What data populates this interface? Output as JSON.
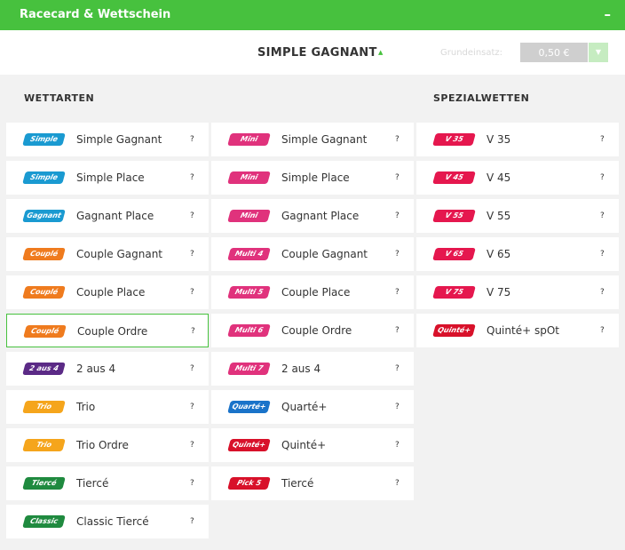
{
  "header": {
    "title": "Racecard & Wettschein",
    "toggle": "–"
  },
  "betbar": {
    "bet_type": "SIMPLE GAGNANT",
    "caret": "▲",
    "stake_label": "Grundeinsatz:",
    "stake_value": "0,50 €",
    "dropdown": "▼"
  },
  "sections": {
    "wettarten": "WETTARTEN",
    "spezialwetten": "SPEZIALWETTEN"
  },
  "help": "?",
  "colors": {
    "accent": "#47c13e"
  },
  "col1": [
    {
      "logo": "Simple",
      "label": "Simple Gagnant",
      "color": "#1a9ad1",
      "icon": "simple-gagnant-logo"
    },
    {
      "logo": "Simple",
      "label": "Simple Place",
      "color": "#1a9ad1",
      "icon": "simple-place-logo"
    },
    {
      "logo": "Gagnant",
      "label": "Gagnant Place",
      "color": "#1a9ad1",
      "icon": "gagnant-place-logo"
    },
    {
      "logo": "Couplé",
      "label": "Couple Gagnant",
      "color": "#ef7b1e",
      "icon": "couple-gagnant-logo"
    },
    {
      "logo": "Couplé",
      "label": "Couple Place",
      "color": "#ef7b1e",
      "icon": "couple-place-logo"
    },
    {
      "logo": "Couplé",
      "label": "Couple Ordre",
      "color": "#ef7b1e",
      "icon": "couple-ordre-logo",
      "selected": true
    },
    {
      "logo": "2 aus 4",
      "label": "2 aus 4",
      "color": "#5b2a86",
      "icon": "2-aus-4-logo"
    },
    {
      "logo": "Trio",
      "label": "Trio",
      "color": "#f5a51c",
      "icon": "trio-logo"
    },
    {
      "logo": "Trio",
      "label": "Trio Ordre",
      "color": "#f5a51c",
      "icon": "trio-ordre-logo"
    },
    {
      "logo": "Tiercé",
      "label": "Tiercé",
      "color": "#1f8a3f",
      "icon": "tierce-logo"
    },
    {
      "logo": "Classic",
      "label": "Classic Tiercé",
      "color": "#1f8a3f",
      "icon": "classic-tierce-logo"
    }
  ],
  "col2": [
    {
      "logo": "Mini",
      "label": "Simple Gagnant",
      "color": "#e0327c",
      "icon": "mini-multi4-logo"
    },
    {
      "logo": "Mini",
      "label": "Simple Place",
      "color": "#e0327c",
      "icon": "mini-multi5-logo"
    },
    {
      "logo": "Mini",
      "label": "Gagnant Place",
      "color": "#e0327c",
      "icon": "mini-multi6-logo"
    },
    {
      "logo": "Multi 4",
      "label": "Couple Gagnant",
      "color": "#e0327c",
      "icon": "multi4-logo"
    },
    {
      "logo": "Multi 5",
      "label": "Couple Place",
      "color": "#e0327c",
      "icon": "multi5-logo"
    },
    {
      "logo": "Multi 6",
      "label": "Couple Ordre",
      "color": "#e0327c",
      "icon": "multi6-logo"
    },
    {
      "logo": "Multi 7",
      "label": "2 aus 4",
      "color": "#e0327c",
      "icon": "multi7-logo"
    },
    {
      "logo": "Quarté+",
      "label": "Quarté+",
      "color": "#1a73c9",
      "icon": "quarte-plus-logo"
    },
    {
      "logo": "Quinté+",
      "label": "Quinté+",
      "color": "#d8112a",
      "icon": "quinte-plus-logo"
    },
    {
      "logo": "Pick 5",
      "label": "Tiercé",
      "color": "#d8112a",
      "icon": "pick-5-logo"
    }
  ],
  "col3": [
    {
      "logo": "V 35",
      "label": "V 35",
      "color": "#e5174e",
      "icon": "v35-logo"
    },
    {
      "logo": "V 45",
      "label": "V 45",
      "color": "#e5174e",
      "icon": "v45-logo"
    },
    {
      "logo": "V 55",
      "label": "V 55",
      "color": "#e5174e",
      "icon": "v55-logo"
    },
    {
      "logo": "V 65",
      "label": "V 65",
      "color": "#e5174e",
      "icon": "v65-logo"
    },
    {
      "logo": "V 75",
      "label": "V 75",
      "color": "#e5174e",
      "icon": "v75-logo"
    },
    {
      "logo": "Quinté+",
      "label": "Quinté+ spOt",
      "color": "#d8112a",
      "icon": "quinte-spot-logo"
    }
  ]
}
